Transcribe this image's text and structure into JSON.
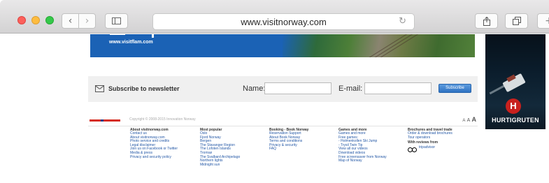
{
  "browser": {
    "url": "www.visitnorway.com"
  },
  "banner": {
    "url_text": "www.visitflam.com"
  },
  "ad": {
    "brand": "HURTIGRUTEN",
    "emblem": "H"
  },
  "newsletter": {
    "label": "Subscribe to newsletter",
    "name_label": "Name:",
    "name_value": "",
    "email_label": "E-mail:",
    "email_value": "",
    "button_label": "Subscribe"
  },
  "footer": {
    "copyright": "Copyright © 2008-2015 Innovation Norway",
    "text_size": [
      "A",
      "A",
      "A"
    ],
    "columns": [
      {
        "title": "About visitnorway.com",
        "links": [
          "Contact us",
          "About visitnorway.com",
          "Photo service and credits",
          "Legal disclaimer",
          "Join us on Facebook or Twitter",
          "Media & press",
          "Privacy and security policy"
        ]
      },
      {
        "title": "Most popular",
        "links": [
          "Oslo",
          "Fjord Norway",
          "Bergen",
          "The Stavanger Region",
          "The Lofoten Islands",
          "Tromsø",
          "The Svalbard Archipelago",
          "Northern lights",
          "Midnight sun"
        ]
      },
      {
        "title": "Booking - Book Norway",
        "links": [
          "Reservation Support",
          "About Book Norway",
          "Terms and conditions",
          "Privacy & security",
          "FAQ"
        ]
      },
      {
        "title": "Games and more",
        "links": [
          "Games and more",
          "Free games:",
          "- Holmenkollen Ski Jump",
          "- Trysil Twin Tip",
          "View all our videos",
          "Download videos",
          "Free screensaver from Norway",
          "Map of Norway"
        ]
      },
      {
        "title": "Brochures and travel trade",
        "links": [
          "Order & download brochures",
          "Tour operators"
        ],
        "reviews_label": "With reviews from",
        "reviews_brand": "tripadvisor"
      }
    ]
  }
}
